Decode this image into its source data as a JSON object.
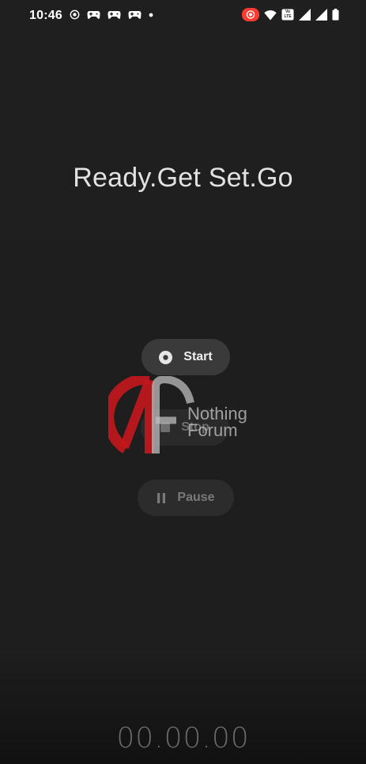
{
  "status_bar": {
    "time": "10:46",
    "left_icons": [
      "record-icon",
      "gamepad-icon",
      "gamepad-icon",
      "gamepad-icon",
      "dot-icon"
    ],
    "right_icons": [
      "screen-record-icon",
      "wifi-icon",
      "volte-icon",
      "signal-icon",
      "signal-icon",
      "battery-icon"
    ],
    "volte_label": "Vo LTE",
    "accent_color": "#ff3b30"
  },
  "title": "Ready.Get Set.Go",
  "buttons": {
    "start": {
      "label": "Start",
      "icon": "record-icon"
    },
    "stop": {
      "label": "Stop",
      "icon": "stop-icon"
    },
    "pause": {
      "label": "Pause",
      "icon": "pause-icon"
    }
  },
  "watermark": {
    "line1": "Nothing",
    "line2": "Forum",
    "accent_color": "#c4161c"
  },
  "timer": "00.00.00"
}
